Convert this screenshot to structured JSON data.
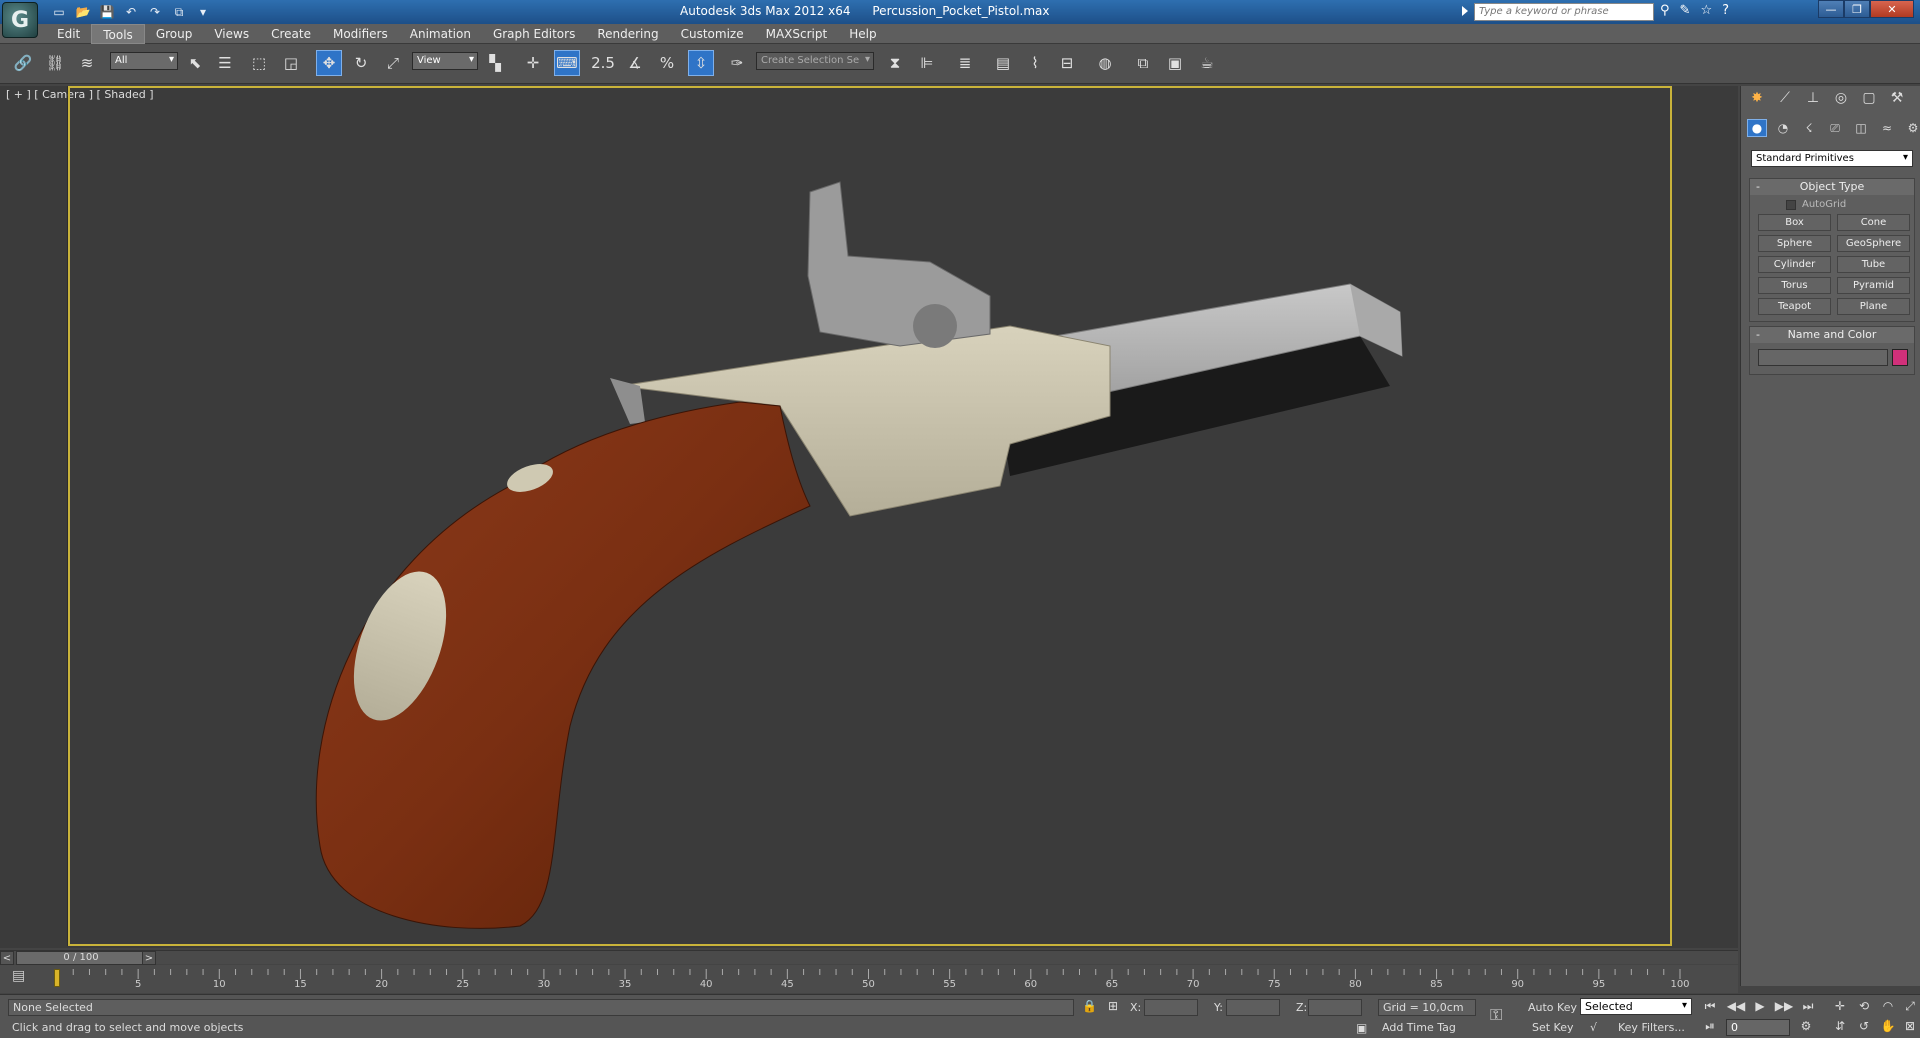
{
  "window": {
    "app_title": "Autodesk 3ds Max  2012 x64",
    "file_name": "Percussion_Pocket_Pistol.max",
    "search_placeholder": "Type a keyword or phrase",
    "logo_glyph": "G",
    "minimize": "—",
    "restore": "❐",
    "close": "✕"
  },
  "quick_access": {
    "new_icon": "▭",
    "open_icon": "📂",
    "save_icon": "💾",
    "undo_icon": "↶",
    "redo_icon": "↷",
    "project_icon": "⧉",
    "more_icon": "▾"
  },
  "title_icons": {
    "binoculars": "⚲",
    "tools": "✎",
    "star": "☆",
    "help": "?"
  },
  "menu": [
    {
      "label": "Edit"
    },
    {
      "label": "Tools"
    },
    {
      "label": "Group"
    },
    {
      "label": "Views"
    },
    {
      "label": "Create"
    },
    {
      "label": "Modifiers"
    },
    {
      "label": "Animation"
    },
    {
      "label": "Graph Editors"
    },
    {
      "label": "Rendering"
    },
    {
      "label": "Customize"
    },
    {
      "label": "MAXScript"
    },
    {
      "label": "Help"
    }
  ],
  "toolbar": {
    "selection_filter": "All",
    "reference_coord": "View",
    "named_selection": "Create Selection Se",
    "angle_snap": "2.5",
    "percent_snap": "%"
  },
  "viewport": {
    "label": "[ + ] [ Camera ] [ Shaded ]",
    "border_color": "#c9b33a"
  },
  "command_panel": {
    "category": "Standard Primitives",
    "object_type_title": "Object Type",
    "autogrid": "AutoGrid",
    "primitives": [
      "Box",
      "Cone",
      "Sphere",
      "GeoSphere",
      "Cylinder",
      "Tube",
      "Torus",
      "Pyramid",
      "Teapot",
      "Plane"
    ],
    "name_color_title": "Name and Color",
    "swatch_color": "#d1307a",
    "collapse": "-"
  },
  "time": {
    "slider_text": "0 / 100",
    "left_arrow": "<",
    "right_arrow": ">",
    "ticks": [
      "5",
      "10",
      "15",
      "20",
      "25",
      "30",
      "35",
      "40",
      "45",
      "50",
      "55",
      "60",
      "65",
      "70",
      "75",
      "80",
      "85",
      "90",
      "95",
      "100"
    ],
    "marker_label": "0"
  },
  "status": {
    "selection": "None Selected",
    "prompt": "Click and drag to select and move objects",
    "x_label": "X:",
    "y_label": "Y:",
    "z_label": "Z:",
    "grid": "Grid = 10,0cm",
    "add_time_tag": "Add Time Tag",
    "auto_key": "Auto Key",
    "set_key": "Set Key",
    "key_mode": "Selected",
    "key_filters": "Key Filters...",
    "frame": "0"
  }
}
